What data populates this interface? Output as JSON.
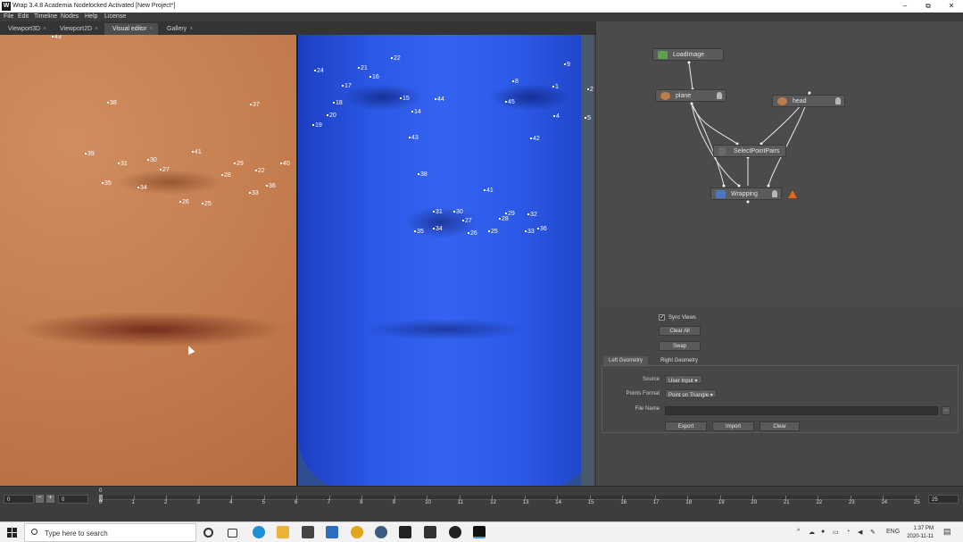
{
  "window": {
    "title": "Wrap 3.4.8 Academia Nodelocked Activated [New Project*]",
    "app_icon": "W",
    "controls": [
      "–",
      "⧉",
      "✕"
    ]
  },
  "menu": [
    "File",
    "Edit",
    "Timeline",
    "Nodes",
    "Help",
    "License"
  ],
  "tabs": [
    {
      "label": "Viewport3D",
      "active": false
    },
    {
      "label": "Viewport2D",
      "active": false
    },
    {
      "label": "Visual editor",
      "active": true
    },
    {
      "label": "Gallery",
      "active": false
    }
  ],
  "left_points": [
    "43",
    "38",
    "37",
    "39",
    "31",
    "30",
    "27",
    "41",
    "29",
    "22",
    "40",
    "35",
    "34",
    "28",
    "36",
    "33",
    "26",
    "25"
  ],
  "right_points": [
    "22",
    "9",
    "24",
    "21",
    "16",
    "8",
    "1",
    "2",
    "17",
    "18",
    "15",
    "44",
    "45",
    "20",
    "14",
    "4",
    "5",
    "19",
    "43",
    "42",
    "38",
    "41",
    "31",
    "30",
    "29",
    "32",
    "27",
    "28",
    "35",
    "34",
    "26",
    "25",
    "33",
    "36"
  ],
  "nodes": {
    "load_image": "LoadImage",
    "plane": "plane",
    "head": "head",
    "select_point_pairs": "SelectPointPairs",
    "wrapping": "Wrapping"
  },
  "props": {
    "sync_views_label": "Sync Views",
    "sync_views_checked": true,
    "clear_all": "Clear All",
    "swap": "Swap",
    "tabs": [
      "Left Geometry",
      "Right Geometry"
    ],
    "source_label": "Source",
    "source_value": "User Input",
    "points_format_label": "Points Format",
    "points_format_value": "Point on Triangle",
    "file_name_label": "File Name",
    "file_name_value": "",
    "browse": "...",
    "export": "Export",
    "import": "Import",
    "clear": "Clear"
  },
  "timeline": {
    "start": "0",
    "current": "0",
    "frame_marker": "0",
    "end": "25",
    "minus": "−",
    "plus": "+",
    "ticks": [
      "0",
      "1",
      "2",
      "3",
      "4",
      "5",
      "6",
      "7",
      "8",
      "9",
      "10",
      "11",
      "12",
      "13",
      "14",
      "15",
      "16",
      "17",
      "18",
      "19",
      "20",
      "21",
      "22",
      "23",
      "24",
      "25"
    ]
  },
  "taskbar": {
    "search_placeholder": "Type here to search",
    "language": "ENG",
    "time": "1:37 PM",
    "date": "2020-11-11"
  }
}
